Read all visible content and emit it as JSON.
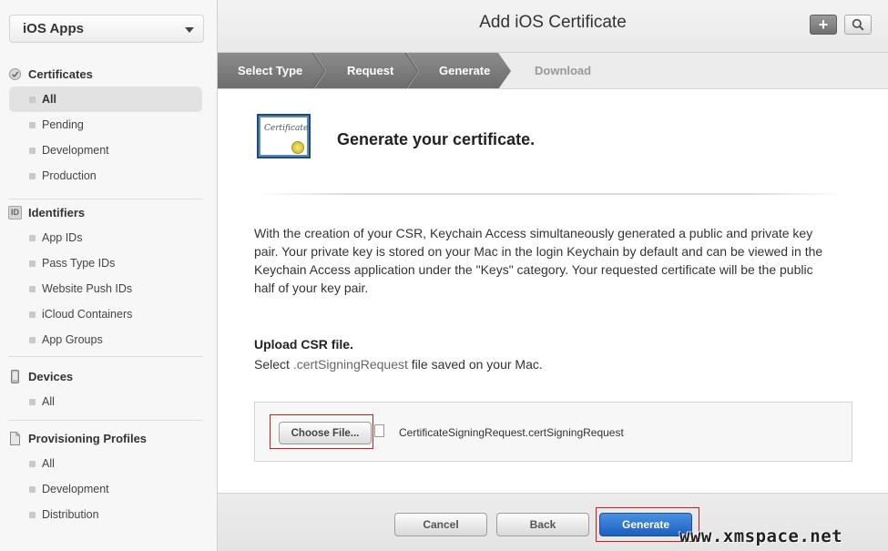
{
  "sidebar": {
    "app_select": "iOS Apps",
    "sections": {
      "certificates": {
        "title": "Certificates",
        "items": [
          "All",
          "Pending",
          "Development",
          "Production"
        ]
      },
      "identifiers": {
        "title": "Identifiers",
        "icon_text": "ID",
        "items": [
          "App IDs",
          "Pass Type IDs",
          "Website Push IDs",
          "iCloud Containers",
          "App Groups"
        ]
      },
      "devices": {
        "title": "Devices",
        "items": [
          "All"
        ]
      },
      "profiles": {
        "title": "Provisioning Profiles",
        "items": [
          "All",
          "Development",
          "Distribution"
        ]
      }
    },
    "active_item": "All"
  },
  "header": {
    "title": "Add iOS Certificate",
    "plus": "+"
  },
  "steps": [
    {
      "label": "Select Type",
      "state": "done"
    },
    {
      "label": "Request",
      "state": "done"
    },
    {
      "label": "Generate",
      "state": "current"
    },
    {
      "label": "Download",
      "state": "pending"
    }
  ],
  "content": {
    "cert_icon_text": "Certificate",
    "title": "Generate your certificate.",
    "description": "With the creation of your CSR, Keychain Access simultaneously generated a public and private key pair. Your private key is stored on your Mac in the login Keychain by default and can be viewed in the Keychain Access application under the \"Keys\" category. Your requested certificate will be the public half of your key pair.",
    "upload_title": "Upload CSR file.",
    "upload_sub_pre": "Select ",
    "upload_sub_code": ".certSigningRequest",
    "upload_sub_post": " file saved on your Mac.",
    "choose_file_label": "Choose File...",
    "file_name": "CertificateSigningRequest.certSigningRequest"
  },
  "footer": {
    "cancel": "Cancel",
    "back": "Back",
    "generate": "Generate"
  },
  "watermark": "www.xmspace.net",
  "colors": {
    "primary_button": "#1b5fbf",
    "highlight_box": "#d01919",
    "step_active": "#7a7a7a"
  }
}
